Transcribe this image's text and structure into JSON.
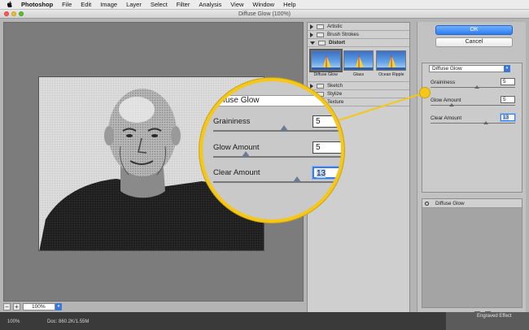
{
  "menubar": {
    "app": "Photoshop",
    "items": [
      "File",
      "Edit",
      "Image",
      "Layer",
      "Select",
      "Filter",
      "Analysis",
      "View",
      "Window",
      "Help"
    ]
  },
  "window": {
    "title": "Diffuse Glow (100%)"
  },
  "preview": {
    "zoom": "100%",
    "doc_info": "Doc: 860.2K/1.55M"
  },
  "gallery": {
    "folders_top": [
      {
        "label": "Artistic",
        "open": false
      },
      {
        "label": "Brush Strokes",
        "open": false
      },
      {
        "label": "Distort",
        "open": true
      }
    ],
    "thumbs": [
      {
        "label": "Diffuse Glow",
        "selected": true
      },
      {
        "label": "Glass",
        "selected": false
      },
      {
        "label": "Ocean Ripple",
        "selected": false
      }
    ],
    "folders_bottom": [
      {
        "label": "Sketch"
      },
      {
        "label": "Stylize"
      },
      {
        "label": "Texture"
      }
    ]
  },
  "buttons": {
    "ok": "OK",
    "cancel": "Cancel"
  },
  "filter_select": "Diffuse Glow",
  "params": [
    {
      "label": "Graininess",
      "value": "5",
      "slider": 0.55,
      "active": false
    },
    {
      "label": "Glow Amount",
      "value": "5",
      "slider": 0.25,
      "active": false
    },
    {
      "label": "Clear Amount",
      "value": "13",
      "slider": 0.65,
      "active": true
    }
  ],
  "layers": {
    "effect": "Diffuse Glow"
  },
  "magnifier": {
    "head": "Diffuse Glow",
    "params": [
      {
        "label": "Graininess",
        "value": "5"
      },
      {
        "label": "Glow Amount",
        "value": "5"
      },
      {
        "label": "Clear Amount",
        "value": "13"
      }
    ]
  },
  "taskbar": {
    "layer_name": "Engraved Effect"
  },
  "colors": {
    "accent": "#f5c71a",
    "ok_blue": "#2f7df2"
  }
}
